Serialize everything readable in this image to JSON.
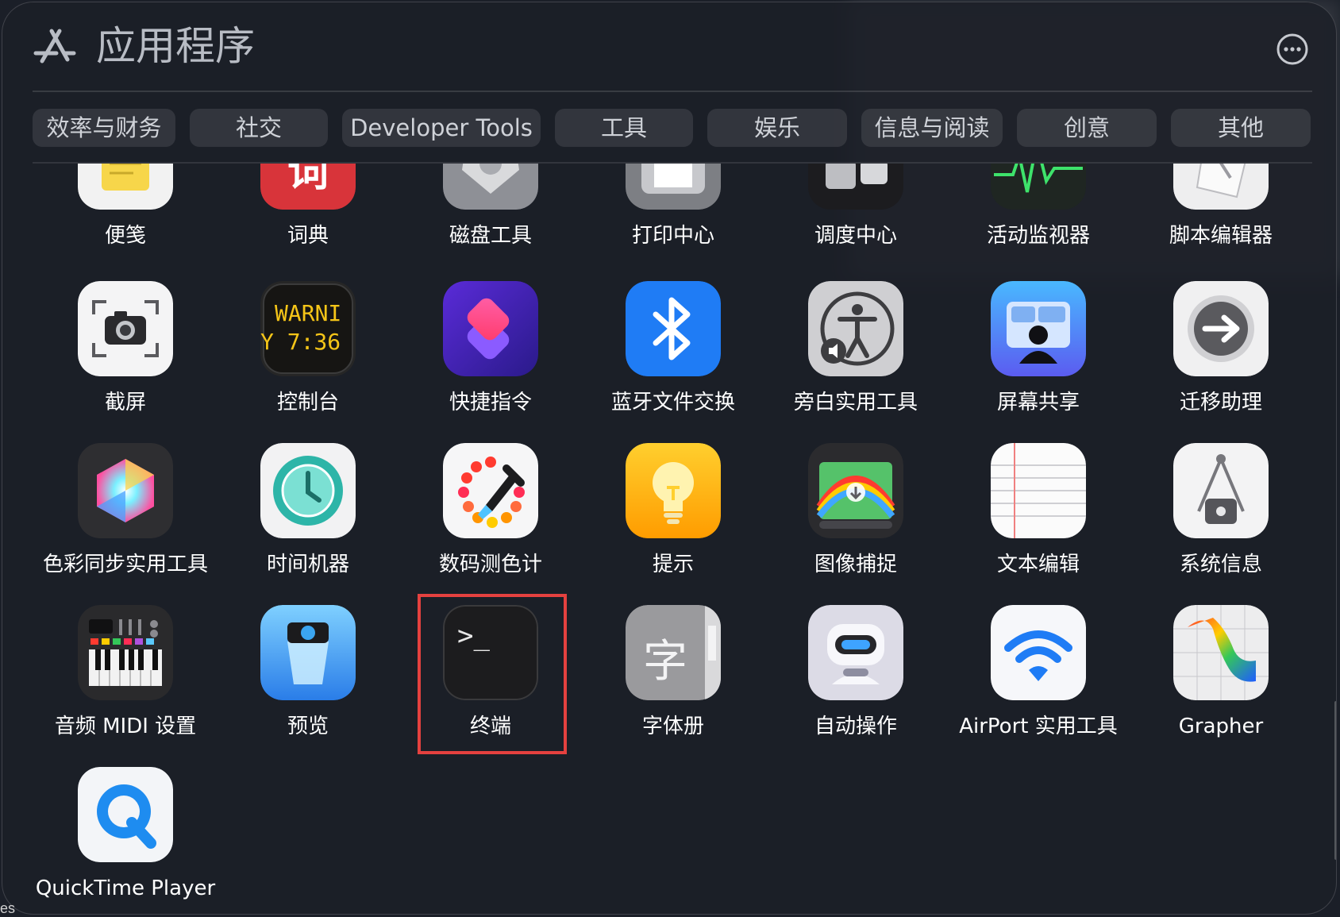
{
  "window": {
    "title": "应用程序"
  },
  "tabs": [
    "效率与财务",
    "社交",
    "Developer Tools",
    "工具",
    "娱乐",
    "信息与阅读",
    "创意",
    "其他"
  ],
  "apps": {
    "row1": [
      "便笺",
      "词典",
      "磁盘工具",
      "打印中心",
      "调度中心",
      "活动监视器",
      "脚本编辑器"
    ],
    "row2": [
      "截屏",
      "控制台",
      "快捷指令",
      "蓝牙文件交换",
      "旁白实用工具",
      "屏幕共享",
      "迁移助理"
    ],
    "row3": [
      "色彩同步实用工具",
      "时间机器",
      "数码测色计",
      "提示",
      "图像捕捉",
      "文本编辑",
      "系统信息"
    ],
    "row4": [
      "音频 MIDI 设置",
      "预览",
      "终端",
      "字体册",
      "自动操作",
      "AirPort 实用工具",
      "Grapher"
    ],
    "row5": [
      "QuickTime Player"
    ]
  },
  "icon_text": {
    "dictionary": "词",
    "console_line1": "WARNI",
    "console_line2": "Y 7:36",
    "fontbook": "字",
    "terminal_prompt": ">_"
  },
  "highlighted_app": "终端",
  "edge_text": "es",
  "colors": {
    "highlight": "#e5413f",
    "accent_blue": "#1f7cf5"
  }
}
